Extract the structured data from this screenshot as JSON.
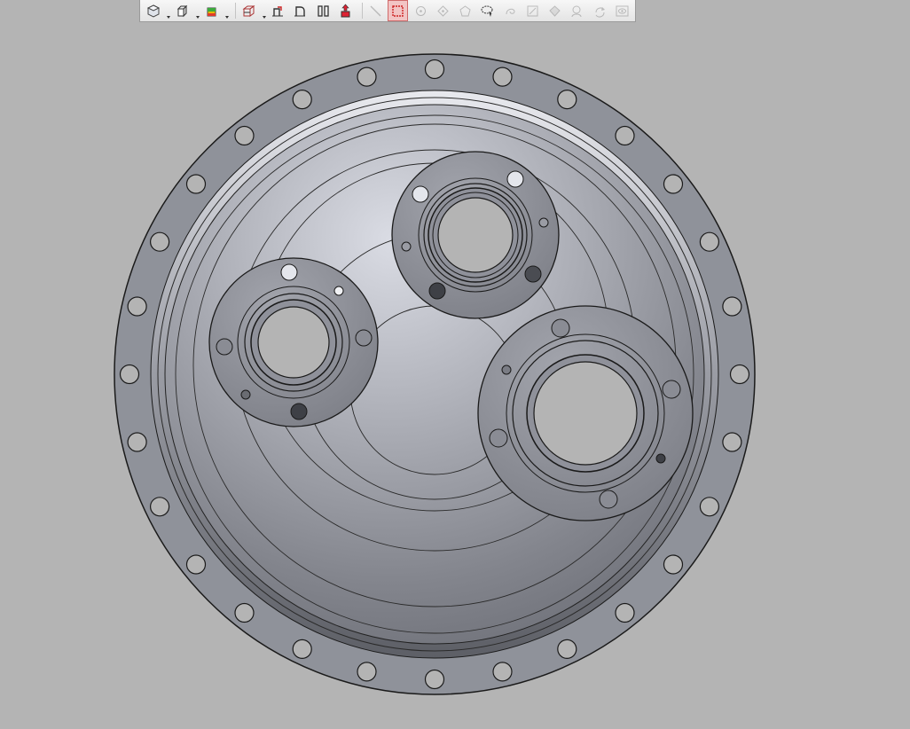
{
  "toolbar": {
    "groups": [
      [
        {
          "name": "view-orientation-button",
          "icon": "hex-view-icon",
          "dropdown": true,
          "enabled": true
        },
        {
          "name": "display-style-button",
          "icon": "shaded-cube-icon",
          "dropdown": true,
          "enabled": true
        },
        {
          "name": "appearance-button",
          "icon": "color-cube-icon",
          "dropdown": true,
          "enabled": true
        }
      ],
      [
        {
          "name": "section-view-button",
          "icon": "section-cube-icon",
          "dropdown": true,
          "enabled": true
        },
        {
          "name": "mirror-button",
          "icon": "mirror-icon",
          "dropdown": false,
          "enabled": true
        },
        {
          "name": "flip-button",
          "icon": "flip-icon",
          "dropdown": false,
          "enabled": true
        },
        {
          "name": "split-view-button",
          "icon": "split-view-icon",
          "dropdown": false,
          "enabled": true
        },
        {
          "name": "explode-button",
          "icon": "explode-icon",
          "dropdown": false,
          "enabled": true
        }
      ],
      [
        {
          "name": "line-tool-button",
          "icon": "line-icon",
          "dropdown": false,
          "enabled": false
        },
        {
          "name": "box-select-button",
          "icon": "box-select-icon",
          "dropdown": false,
          "enabled": true,
          "active": true
        },
        {
          "name": "point-tool-button",
          "icon": "circle-point-icon",
          "dropdown": false,
          "enabled": false
        },
        {
          "name": "vertex-tool-button",
          "icon": "diamond-point-icon",
          "dropdown": false,
          "enabled": false
        },
        {
          "name": "polygon-tool-button",
          "icon": "polygon-icon",
          "dropdown": false,
          "enabled": false
        },
        {
          "name": "lasso-select-button",
          "icon": "lasso-icon",
          "dropdown": false,
          "enabled": true
        },
        {
          "name": "loop-tool-button",
          "icon": "loop-icon",
          "dropdown": false,
          "enabled": false
        },
        {
          "name": "sketch-tool-button",
          "icon": "sketch-icon",
          "dropdown": false,
          "enabled": false
        },
        {
          "name": "face-tool-button",
          "icon": "face-icon",
          "dropdown": false,
          "enabled": false
        },
        {
          "name": "zoom-tool-button",
          "icon": "zoom-icon",
          "dropdown": false,
          "enabled": false
        },
        {
          "name": "rotate-tool-button",
          "icon": "rotate-icon",
          "dropdown": false,
          "enabled": false
        },
        {
          "name": "visibility-button",
          "icon": "eye-icon",
          "dropdown": false,
          "enabled": false
        }
      ]
    ]
  },
  "viewport": {
    "model": "flanged-end-cover",
    "background_color": "#b4b4b4",
    "flange_color": "#8e9199",
    "dome_highlight": "#d6d8e0",
    "dome_shadow": "#6e7078",
    "bolt_hole_count": 28
  }
}
